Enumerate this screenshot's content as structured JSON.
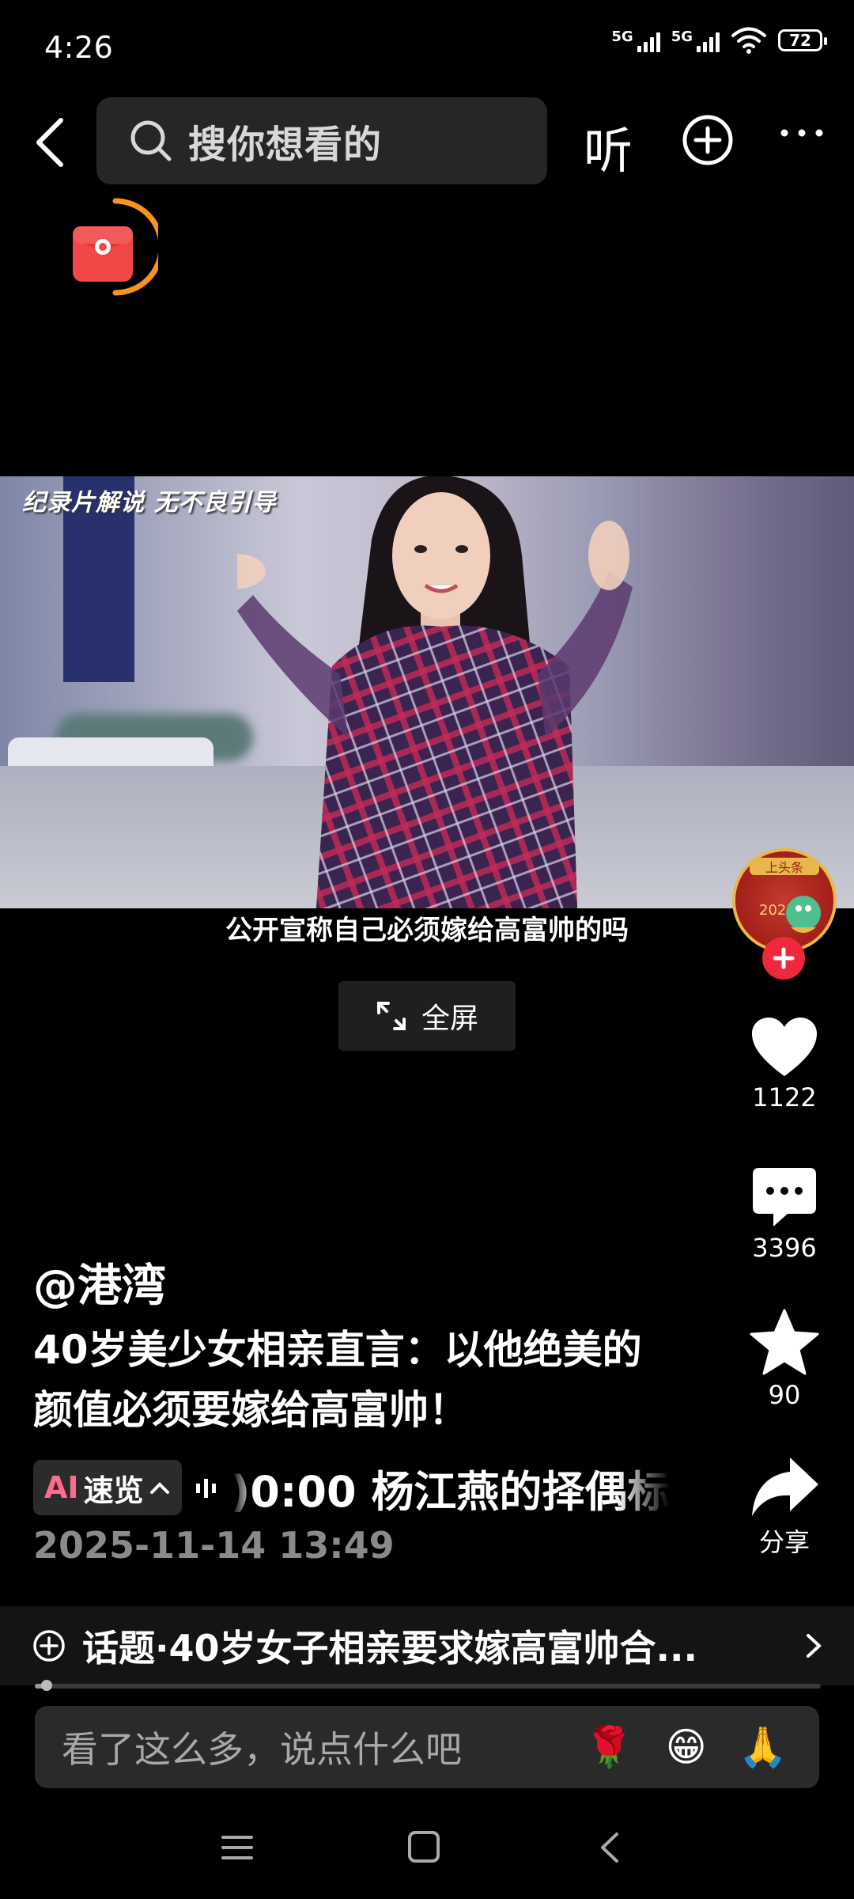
{
  "status_bar": {
    "time": "4:26",
    "network_1": "5G",
    "network_2": "5G",
    "battery": "72"
  },
  "top_bar": {
    "search_placeholder": "搜你想看的",
    "listen_label": "听"
  },
  "video": {
    "watermark": "纪录片解说 无不良引导",
    "subtitle": "公开宣称自己必须嫁给高富帅的吗",
    "fullscreen_label": "全屏",
    "progress_percent": 1.5
  },
  "actions": {
    "likes": "1122",
    "comments": "3396",
    "favorites": "90",
    "share_label": "分享"
  },
  "caption": {
    "author": "@港湾",
    "description": "40岁美少女相亲直言：以他绝美的颜值必须要嫁给高富帅！",
    "ai_prefix": "AI",
    "ai_label": "速览",
    "ai_summary": ")0:00 杨江燕的择偶标",
    "date": "2025-11-14 13:49"
  },
  "topic": {
    "text": "话题·40岁女子相亲要求嫁高富帅合..."
  },
  "comment": {
    "placeholder": "看了这么多，说点什么吧",
    "emojis": [
      "🌹",
      "😁",
      "🙏"
    ]
  },
  "colors": {
    "accent_red": "#f0283d",
    "red_packet_ring": "#f7931e"
  },
  "icons": [
    "back-icon",
    "search-icon",
    "add-circle-icon",
    "more-icon",
    "red-packet-icon",
    "expand-icon",
    "heart-icon",
    "comment-icon",
    "star-icon",
    "share-icon",
    "topic-icon",
    "chevron-right-icon",
    "menu-icon",
    "home-icon",
    "nav-back-icon"
  ]
}
